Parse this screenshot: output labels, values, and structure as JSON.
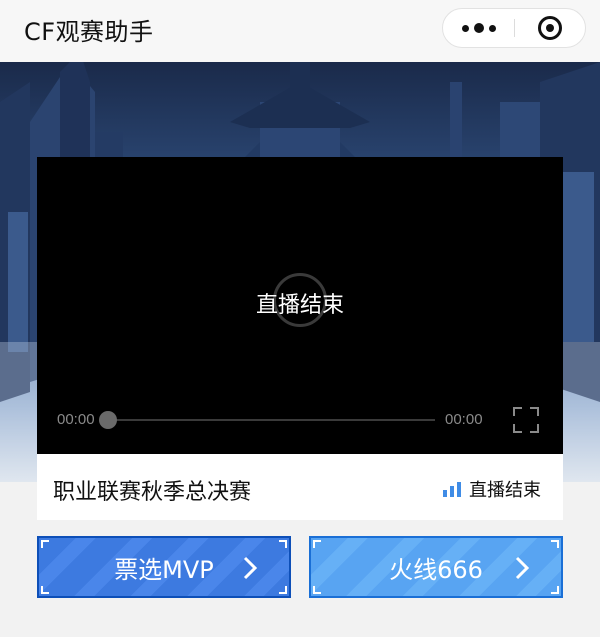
{
  "titlebar": {
    "title": "CF观赛助手",
    "more_icon": "more-dots-icon",
    "close_icon": "target-close-icon"
  },
  "player": {
    "status_text": "直播结束",
    "current_time": "00:00",
    "duration": "00:00",
    "progress": 0,
    "fullscreen_icon": "fullscreen-icon"
  },
  "info": {
    "event_title": "职业联赛秋季总决赛",
    "live_status_icon": "signal-bars-icon",
    "live_status_text": "直播结束",
    "accent_color": "#3f8ce6"
  },
  "buttons": {
    "mvp_label": "票选MVP",
    "huoxian_label": "火线666",
    "chevron_icon": "chevron-right-icon"
  }
}
